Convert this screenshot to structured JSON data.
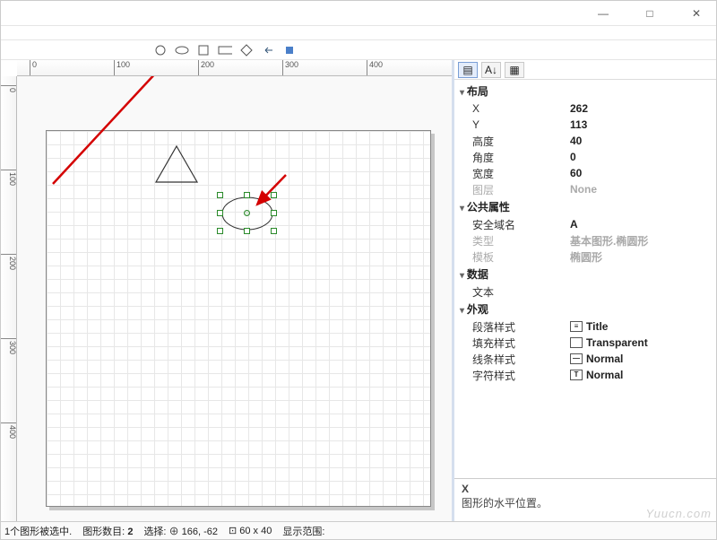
{
  "titlebar": {
    "min": "—",
    "max": "□",
    "close": "✕"
  },
  "toolbar": {
    "shapes": [
      "circle",
      "ellipse",
      "square",
      "rectangle",
      "diamond",
      "arrow-left",
      "misc"
    ]
  },
  "ruler": {
    "h": [
      "0",
      "100",
      "200",
      "300",
      "400"
    ],
    "v": [
      "0",
      "100",
      "200",
      "300",
      "400"
    ]
  },
  "props": {
    "sections": {
      "layout": {
        "title": "布局",
        "rows": [
          {
            "k": "X",
            "v": "262"
          },
          {
            "k": "Y",
            "v": "113"
          },
          {
            "k": "高度",
            "v": "40"
          },
          {
            "k": "角度",
            "v": "0"
          },
          {
            "k": "宽度",
            "v": "60"
          },
          {
            "k": "图层",
            "v": "None",
            "dis": true
          }
        ]
      },
      "common": {
        "title": "公共属性",
        "rows": [
          {
            "k": "安全域名",
            "v": "A"
          },
          {
            "k": "类型",
            "v": "基本图形.椭圆形",
            "dis": true
          },
          {
            "k": "模板",
            "v": "椭圆形",
            "dis": true
          }
        ]
      },
      "data": {
        "title": "数据",
        "rows": [
          {
            "k": "文本",
            "v": ""
          }
        ]
      },
      "appearance": {
        "title": "外观",
        "rows": [
          {
            "k": "段落样式",
            "v": "Title",
            "icon": "≡"
          },
          {
            "k": "填充样式",
            "v": "Transparent",
            "icon": ""
          },
          {
            "k": "线条样式",
            "v": "Normal",
            "icon": "—"
          },
          {
            "k": "字符样式",
            "v": "Normal",
            "icon": "T"
          }
        ]
      }
    }
  },
  "desc": {
    "name": "X",
    "text": "图形的水平位置。"
  },
  "status": {
    "sel": "1个图形被选中.",
    "count_label": "图形数目:",
    "count": "2",
    "pick_label": "选择:",
    "pick": "⊕ 166, -62",
    "size": "⊡ 60 x 40",
    "range_label": "显示范围:"
  },
  "watermark": "Yuucn.com"
}
